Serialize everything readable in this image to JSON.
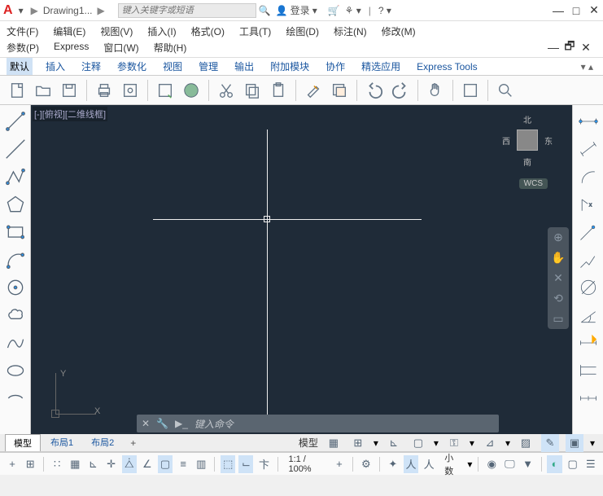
{
  "titlebar": {
    "doc_name": "Drawing1...",
    "search_placeholder": "键入关键字或短语",
    "login": "登录"
  },
  "menu": {
    "row1": [
      "文件(F)",
      "编辑(E)",
      "视图(V)",
      "插入(I)",
      "格式(O)",
      "工具(T)",
      "绘图(D)",
      "标注(N)",
      "修改(M)"
    ],
    "row2": [
      "参数(P)",
      "Express",
      "窗口(W)",
      "帮助(H)"
    ]
  },
  "tabs": [
    "默认",
    "插入",
    "注释",
    "参数化",
    "视图",
    "管理",
    "输出",
    "附加模块",
    "协作",
    "精选应用",
    "Express Tools"
  ],
  "canvas": {
    "label": "[-][俯视][二维线框]",
    "compass": {
      "n": "北",
      "s": "南",
      "e": "东",
      "w": "西"
    },
    "wcs": "WCS",
    "ucs_x": "X",
    "ucs_y": "Y",
    "cmd_placeholder": "键入命令"
  },
  "layout": {
    "tabs": [
      "模型",
      "布局1",
      "布局2"
    ],
    "right_label": "模型"
  },
  "status": {
    "zoom": "1:1 / 100%",
    "decimal": "小数"
  }
}
